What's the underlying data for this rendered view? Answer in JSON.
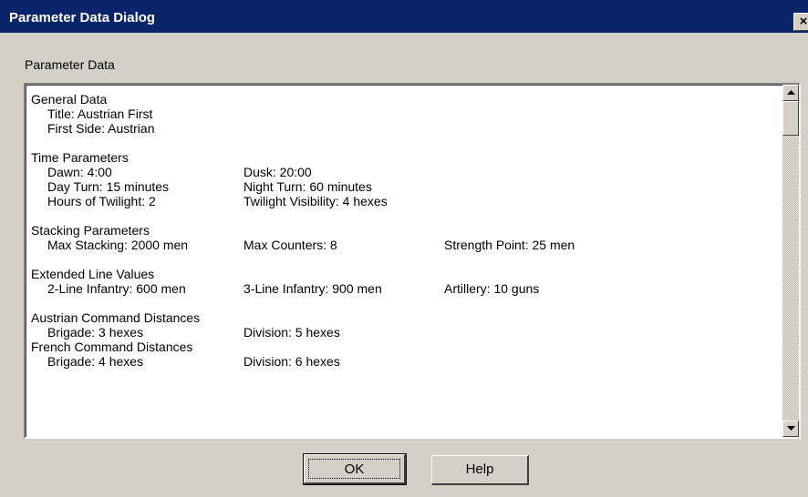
{
  "window": {
    "title": "Parameter Data Dialog",
    "close_label": "×"
  },
  "group_label": "Parameter Data",
  "sections": {
    "general": {
      "heading": "General Data",
      "title": "Title: Austrian First",
      "first_side": "First Side: Austrian"
    },
    "time": {
      "heading": "Time Parameters",
      "dawn": "Dawn: 4:00",
      "dusk": "Dusk: 20:00",
      "day_turn": "Day Turn: 15 minutes",
      "night_turn": "Night Turn: 60 minutes",
      "hours_twilight": "Hours of Twilight: 2",
      "twilight_visibility": "Twilight Visibility: 4 hexes"
    },
    "stacking": {
      "heading": "Stacking Parameters",
      "max_stacking": "Max Stacking: 2000 men",
      "max_counters": "Max Counters: 8",
      "strength_point": "Strength Point: 25 men"
    },
    "extended_line": {
      "heading": "Extended Line Values",
      "two_line": "2-Line Infantry: 600 men",
      "three_line": "3-Line Infantry: 900 men",
      "artillery": "Artillery: 10 guns"
    },
    "austrian_command": {
      "heading": "Austrian Command Distances",
      "brigade": "Brigade: 3 hexes",
      "division": "Division: 5 hexes"
    },
    "french_command": {
      "heading": "French Command Distances",
      "brigade": "Brigade: 4 hexes",
      "division": "Division: 6 hexes"
    }
  },
  "buttons": {
    "ok": "OK",
    "help": "Help"
  }
}
